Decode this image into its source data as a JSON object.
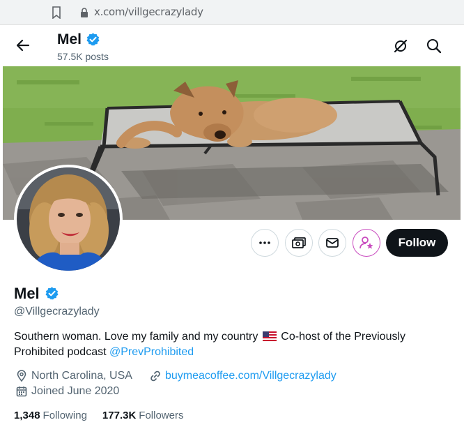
{
  "browser": {
    "url": "x.com/villgecrazylady"
  },
  "header": {
    "name": "Mel",
    "posts": "57.5K posts"
  },
  "actions": {
    "follow_label": "Follow"
  },
  "profile": {
    "name": "Mel",
    "handle": "@Villgecrazylady",
    "bio_line1": "Southern woman. Love my family and my country",
    "bio_line1b": "Co-host of the Previously",
    "bio_line2": "Prohibited podcast",
    "bio_mention": "@PrevProhibited",
    "location": "North Carolina, USA",
    "website": "buymeacoffee.com/Villgecrazylady",
    "joined": "Joined June 2020",
    "following_count": "1,348",
    "following_label": "Following",
    "followers_count": "177.3K",
    "followers_label": "Followers"
  },
  "icons": {
    "back": "arrow-left-icon",
    "verified": "verified-badge-icon",
    "grok": "grok-icon",
    "search": "search-icon",
    "more": "more-icon",
    "tip": "money-icon",
    "message": "envelope-icon",
    "subscribe": "subscribe-icon",
    "location": "location-icon",
    "link": "link-icon",
    "calendar": "calendar-icon"
  },
  "colors": {
    "accent": "#1d9bf0",
    "text": "#0f1419",
    "secondary": "#536471",
    "follow_bg": "#0f1419",
    "subscribe": "#c94cbf"
  }
}
